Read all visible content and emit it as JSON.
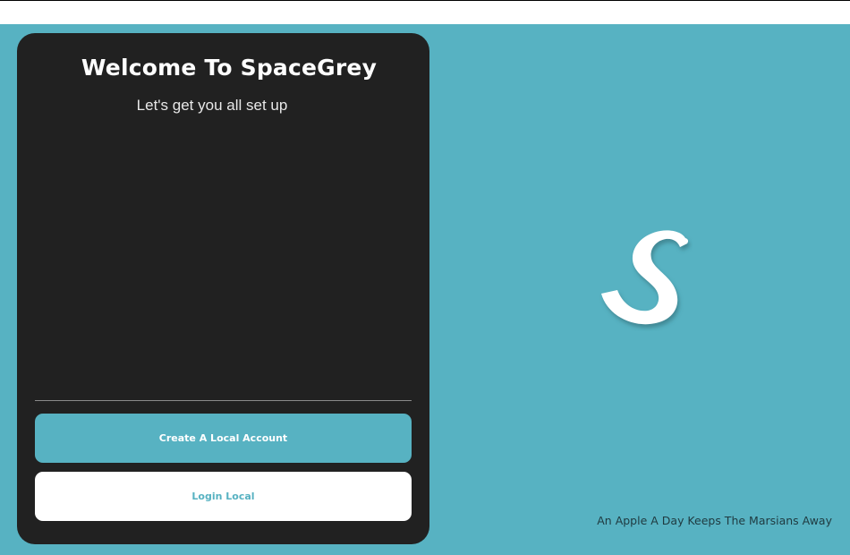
{
  "setup_card": {
    "title": "Welcome To SpaceGrey",
    "subtitle": "Let's get you all set up",
    "create_account_label": "Create A Local Account",
    "login_label": "Login Local"
  },
  "hero": {
    "logo_icon": "s-logo-icon",
    "tagline": "An Apple A Day Keeps The Marsians Away"
  },
  "colors": {
    "accent": "#57b2c2",
    "card_background": "#212121",
    "button_text_light": "#ffffff"
  }
}
